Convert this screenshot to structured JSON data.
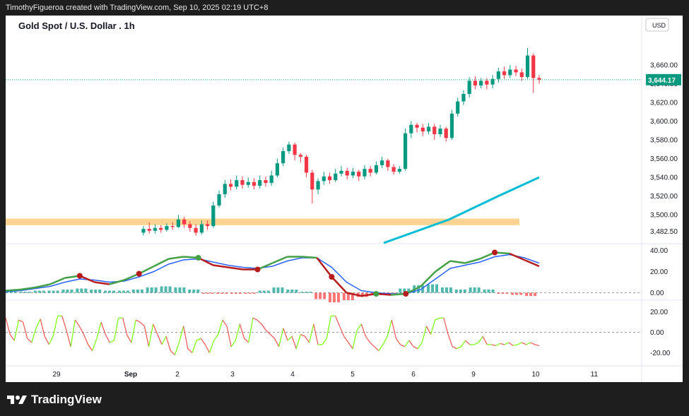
{
  "header": {
    "caption": "TimothyFigueroa created with TradingView.com, Sep 10, 2025 02:19 UTC+8"
  },
  "footer": {
    "brand": "TradingView"
  },
  "chart_data": {
    "type": "candlestick",
    "title": "Gold Spot / U.S. Dollar . 1h",
    "currency": "USD",
    "last_price_label": "3,644.17",
    "last_price": 3644.17,
    "price_axis": {
      "range": [
        3470,
        3690
      ],
      "ticks": [
        "3,660.00",
        "3,640.00",
        "3,620.00",
        "3,600.00",
        "3,580.00",
        "3,560.00",
        "3,540.00",
        "3,520.00",
        "3,500.00",
        "3,482.50"
      ]
    },
    "x_axis": {
      "labels": [
        "29",
        "Sep",
        "2",
        "3",
        "4",
        "5",
        "6",
        "9",
        "10",
        "11"
      ]
    },
    "support_zone": [
      3489,
      3496
    ],
    "moving_average": [
      [
        0.62,
        3470
      ],
      [
        0.78,
        3495
      ],
      [
        0.9,
        3520
      ],
      [
        1.0,
        3540
      ]
    ],
    "candles": [
      [
        3481,
        3485,
        3478,
        3488
      ],
      [
        3485,
        3483,
        3480,
        3492
      ],
      [
        3483,
        3486,
        3480,
        3490
      ],
      [
        3486,
        3484,
        3481,
        3489
      ],
      [
        3484,
        3488,
        3482,
        3491
      ],
      [
        3488,
        3487,
        3484,
        3492
      ],
      [
        3487,
        3495,
        3486,
        3500
      ],
      [
        3495,
        3490,
        3486,
        3498
      ],
      [
        3490,
        3486,
        3482,
        3493
      ],
      [
        3486,
        3481,
        3478,
        3490
      ],
      [
        3481,
        3490,
        3479,
        3494
      ],
      [
        3490,
        3488,
        3484,
        3494
      ],
      [
        3488,
        3510,
        3486,
        3514
      ],
      [
        3510,
        3522,
        3508,
        3526
      ],
      [
        3522,
        3533,
        3518,
        3537
      ],
      [
        3533,
        3530,
        3526,
        3538
      ],
      [
        3530,
        3537,
        3527,
        3542
      ],
      [
        3537,
        3532,
        3528,
        3541
      ],
      [
        3532,
        3535,
        3529,
        3540
      ],
      [
        3535,
        3531,
        3527,
        3539
      ],
      [
        3531,
        3537,
        3528,
        3542
      ],
      [
        3537,
        3534,
        3530,
        3541
      ],
      [
        3534,
        3542,
        3531,
        3547
      ],
      [
        3542,
        3555,
        3540,
        3560
      ],
      [
        3555,
        3568,
        3552,
        3572
      ],
      [
        3568,
        3575,
        3565,
        3578
      ],
      [
        3575,
        3564,
        3558,
        3577
      ],
      [
        3564,
        3562,
        3556,
        3566
      ],
      [
        3562,
        3545,
        3540,
        3564
      ],
      [
        3545,
        3527,
        3512,
        3548
      ],
      [
        3527,
        3536,
        3522,
        3539
      ],
      [
        3536,
        3541,
        3532,
        3546
      ],
      [
        3541,
        3537,
        3533,
        3545
      ],
      [
        3537,
        3544,
        3535,
        3549
      ],
      [
        3544,
        3547,
        3541,
        3552
      ],
      [
        3547,
        3542,
        3538,
        3550
      ],
      [
        3542,
        3546,
        3539,
        3550
      ],
      [
        3546,
        3541,
        3536,
        3548
      ],
      [
        3541,
        3549,
        3538,
        3553
      ],
      [
        3549,
        3545,
        3541,
        3552
      ],
      [
        3545,
        3553,
        3543,
        3557
      ],
      [
        3553,
        3558,
        3550,
        3562
      ],
      [
        3558,
        3551,
        3547,
        3560
      ],
      [
        3551,
        3546,
        3543,
        3554
      ],
      [
        3546,
        3549,
        3544,
        3552
      ],
      [
        3549,
        3587,
        3547,
        3592
      ],
      [
        3587,
        3596,
        3582,
        3600
      ],
      [
        3596,
        3593,
        3588,
        3598
      ],
      [
        3593,
        3589,
        3584,
        3597
      ],
      [
        3589,
        3594,
        3586,
        3598
      ],
      [
        3594,
        3586,
        3580,
        3597
      ],
      [
        3586,
        3592,
        3583,
        3596
      ],
      [
        3592,
        3582,
        3578,
        3594
      ],
      [
        3582,
        3608,
        3580,
        3612
      ],
      [
        3608,
        3621,
        3605,
        3625
      ],
      [
        3621,
        3629,
        3617,
        3633
      ],
      [
        3629,
        3643,
        3625,
        3647
      ],
      [
        3643,
        3638,
        3634,
        3648
      ],
      [
        3638,
        3643,
        3635,
        3646
      ],
      [
        3643,
        3639,
        3634,
        3646
      ],
      [
        3639,
        3645,
        3635,
        3649
      ],
      [
        3645,
        3653,
        3641,
        3657
      ],
      [
        3653,
        3649,
        3645,
        3658
      ],
      [
        3649,
        3655,
        3646,
        3660
      ],
      [
        3655,
        3652,
        3648,
        3659
      ],
      [
        3652,
        3647,
        3643,
        3656
      ],
      [
        3647,
        3670,
        3645,
        3678
      ],
      [
        3670,
        3646,
        3630,
        3672
      ],
      [
        3646,
        3644.17,
        3640,
        3649
      ]
    ],
    "oscillator": {
      "ticks": [
        "40.00",
        "20.00",
        "0.00"
      ],
      "range": [
        -5,
        45
      ],
      "line_fast": [
        2,
        3,
        5,
        8,
        14,
        16,
        10,
        8,
        12,
        18,
        25,
        32,
        34,
        33,
        26,
        24,
        22,
        22,
        28,
        34,
        34,
        33,
        15,
        0,
        -3,
        -1,
        -2,
        -1,
        6,
        20,
        30,
        28,
        32,
        38,
        37,
        31,
        25
      ],
      "line_slow": [
        1,
        2,
        4,
        6,
        10,
        13,
        12,
        10,
        11,
        15,
        20,
        27,
        31,
        32,
        29,
        26,
        24,
        23,
        25,
        30,
        33,
        33,
        24,
        10,
        2,
        0,
        -1,
        -1,
        3,
        13,
        23,
        26,
        29,
        34,
        36,
        33,
        28
      ],
      "histogram": [
        1,
        1,
        2,
        2,
        3,
        4,
        3,
        2,
        2,
        3,
        5,
        6,
        5,
        3,
        -1,
        -1,
        -1,
        -1,
        2,
        5,
        3,
        1,
        -6,
        -9,
        -7,
        -4,
        -2,
        -1,
        4,
        7,
        8,
        5,
        3,
        5,
        3,
        -1,
        -2,
        -3
      ],
      "cross_points": [
        [
          5,
          "down"
        ],
        [
          9,
          "down"
        ],
        [
          13,
          "up"
        ],
        [
          17,
          "down"
        ],
        [
          22,
          "down"
        ],
        [
          25,
          "up"
        ],
        [
          27,
          "down"
        ],
        [
          33,
          "down"
        ]
      ]
    },
    "momentum": {
      "ticks": [
        "20.00",
        "0.00",
        "-20.00"
      ],
      "range": [
        -30,
        30
      ],
      "values": [
        14,
        -2,
        -8,
        12,
        10,
        -6,
        -10,
        4,
        13,
        -4,
        -12,
        -3,
        16,
        16,
        2,
        -14,
        12,
        6,
        -2,
        -12,
        -18,
        -6,
        10,
        -2,
        -10,
        -8,
        14,
        14,
        -3,
        -10,
        12,
        10,
        6,
        -14,
        8,
        -2,
        -12,
        -4,
        -18,
        -22,
        -10,
        6,
        -16,
        -20,
        -8,
        -6,
        -12,
        -20,
        -8,
        -2,
        12,
        6,
        -14,
        -8,
        8,
        -6,
        -10,
        14,
        12,
        8,
        2,
        -2,
        -6,
        -14,
        4,
        -8,
        -4,
        -16,
        -2,
        -4,
        -10,
        8,
        -12,
        -12,
        -6,
        16,
        16,
        6,
        -4,
        -10,
        -16,
        2,
        8,
        -4,
        -10,
        -14,
        -18,
        -12,
        -4,
        12,
        -6,
        -12,
        -14,
        -8,
        -14,
        -16,
        -10,
        6,
        -2,
        12,
        14,
        14,
        -2,
        -14,
        -16,
        -14,
        -8,
        -12,
        -12,
        -10,
        -4,
        -12,
        -12,
        -13,
        -11,
        -12,
        -10,
        -13,
        -12,
        -10,
        -12,
        -10,
        -12,
        -13
      ]
    }
  }
}
